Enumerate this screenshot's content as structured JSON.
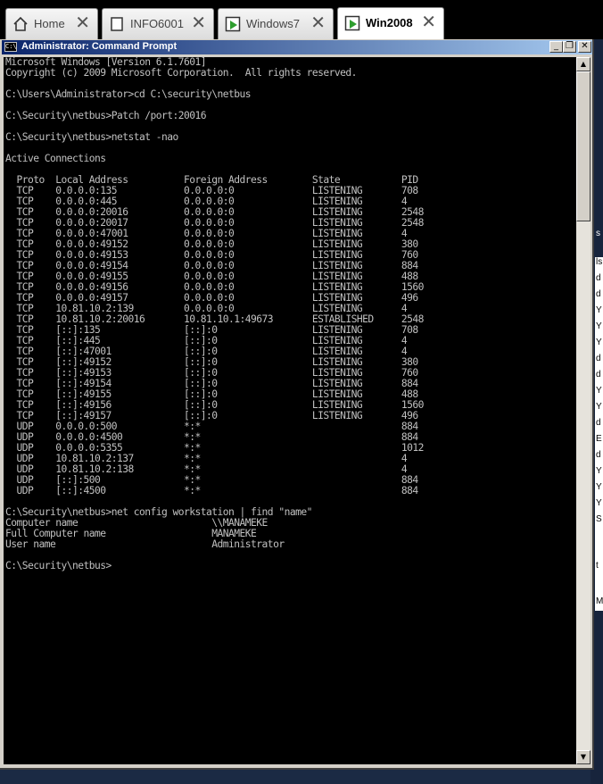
{
  "tabs": [
    {
      "label": "Home",
      "icon": "home-icon",
      "close": "✕"
    },
    {
      "label": "INFO6001",
      "icon": "document-icon",
      "close": "✕"
    },
    {
      "label": "Windows7",
      "icon": "vm-play-icon",
      "close": "✕"
    },
    {
      "label": "Win2008",
      "icon": "vm-play-icon",
      "close": "✕"
    }
  ],
  "window": {
    "title": "Administrator: Command Prompt",
    "icon_text": "C:\\",
    "buttons": {
      "minimize": "_",
      "restore": "❐",
      "close": "✕"
    }
  },
  "console": {
    "lines": [
      "Microsoft Windows [Version 6.1.7601]",
      "Copyright (c) 2009 Microsoft Corporation.  All rights reserved.",
      "",
      "C:\\Users\\Administrator>cd C:\\security\\netbus",
      "",
      "C:\\Security\\netbus>Patch /port:20016",
      "",
      "C:\\Security\\netbus>netstat -nao",
      "",
      "Active Connections",
      "",
      "  Proto  Local Address          Foreign Address        State           PID",
      "  TCP    0.0.0.0:135            0.0.0.0:0              LISTENING       708",
      "  TCP    0.0.0.0:445            0.0.0.0:0              LISTENING       4",
      "  TCP    0.0.0.0:20016          0.0.0.0:0              LISTENING       2548",
      "  TCP    0.0.0.0:20017          0.0.0.0:0              LISTENING       2548",
      "  TCP    0.0.0.0:47001          0.0.0.0:0              LISTENING       4",
      "  TCP    0.0.0.0:49152          0.0.0.0:0              LISTENING       380",
      "  TCP    0.0.0.0:49153          0.0.0.0:0              LISTENING       760",
      "  TCP    0.0.0.0:49154          0.0.0.0:0              LISTENING       884",
      "  TCP    0.0.0.0:49155          0.0.0.0:0              LISTENING       488",
      "  TCP    0.0.0.0:49156          0.0.0.0:0              LISTENING       1560",
      "  TCP    0.0.0.0:49157          0.0.0.0:0              LISTENING       496",
      "  TCP    10.81.10.2:139         0.0.0.0:0              LISTENING       4",
      "  TCP    10.81.10.2:20016       10.81.10.1:49673       ESTABLISHED     2548",
      "  TCP    [::]:135               [::]:0                 LISTENING       708",
      "  TCP    [::]:445               [::]:0                 LISTENING       4",
      "  TCP    [::]:47001             [::]:0                 LISTENING       4",
      "  TCP    [::]:49152             [::]:0                 LISTENING       380",
      "  TCP    [::]:49153             [::]:0                 LISTENING       760",
      "  TCP    [::]:49154             [::]:0                 LISTENING       884",
      "  TCP    [::]:49155             [::]:0                 LISTENING       488",
      "  TCP    [::]:49156             [::]:0                 LISTENING       1560",
      "  TCP    [::]:49157             [::]:0                 LISTENING       496",
      "  UDP    0.0.0.0:500            *:*                                    884",
      "  UDP    0.0.0.0:4500           *:*                                    884",
      "  UDP    0.0.0.0:5355           *:*                                    1012",
      "  UDP    10.81.10.2:137         *:*                                    4",
      "  UDP    10.81.10.2:138         *:*                                    4",
      "  UDP    [::]:500               *:*                                    884",
      "  UDP    [::]:4500              *:*                                    884",
      "",
      "C:\\Security\\netbus>net config workstation | find \"name\"",
      "Computer name                        \\\\MANAMEKE",
      "Full Computer name                   MANAMEKE",
      "User name                            Administrator",
      "",
      "C:\\Security\\netbus>"
    ]
  },
  "scrollbar": {
    "up": "▲",
    "down": "▼"
  },
  "background_window": {
    "letters": [
      "s",
      "ls",
      "d",
      "d",
      "Y",
      "Y",
      "Y",
      "d",
      "d",
      "Y",
      "Y",
      "d",
      "E",
      "d",
      "Y",
      "Y",
      "Y",
      "S",
      "t",
      "M"
    ]
  }
}
